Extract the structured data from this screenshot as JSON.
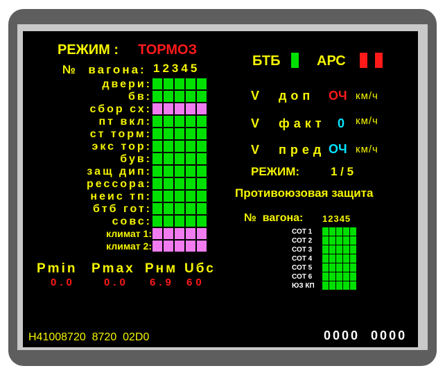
{
  "header": {
    "mode_label": "РЕЖИМ :",
    "mode_value": "ТОРМОЗ",
    "car_label": "№  вагона:",
    "car_numbers": "12345"
  },
  "left_rows": [
    {
      "label": "двери:",
      "state": "green"
    },
    {
      "label": "бв:",
      "state": "green"
    },
    {
      "label": "сбор сх:",
      "state": "pink"
    },
    {
      "label": "пт вкл:",
      "state": "green"
    },
    {
      "label": "ст торм:",
      "state": "green"
    },
    {
      "label": "экс тор:",
      "state": "green"
    },
    {
      "label": "був:",
      "state": "green"
    },
    {
      "label": "защ дип:",
      "state": "green"
    },
    {
      "label": "рессора:",
      "state": "green"
    },
    {
      "label": "неис тп:",
      "state": "green"
    },
    {
      "label": "бтб гот:",
      "state": "green"
    },
    {
      "label": "совс:",
      "state": "green"
    },
    {
      "label": "климат 1:",
      "state": "pink"
    },
    {
      "label": "климат 2:",
      "state": "pink"
    }
  ],
  "pressure": {
    "labels": [
      "Pmin",
      "Pmax",
      "Pнм",
      "Uбс"
    ],
    "values": [
      "0.0",
      "0.0",
      "6.9",
      "60"
    ]
  },
  "right": {
    "btb_label": "БТБ",
    "btb_color": "#00e000",
    "ars_label": "АРС",
    "ars_color": "#ff1a1a",
    "v_dop_label": "V  доп",
    "v_dop_value": "ОЧ",
    "v_dop_unit": "км/ч",
    "v_fakt_label": "V  факт",
    "v_fakt_value": "0",
    "v_fakt_unit": "км/ч",
    "v_pred_label": "V  пред",
    "v_pred_value": "ОЧ",
    "v_pred_unit": "км/ч",
    "mode_label": "РЕЖИМ:",
    "mode_value": "1 / 5",
    "antiskid_title": "Противоюзовая защита",
    "car_label": "№  вагона:",
    "car_numbers": "12345",
    "sot_rows": [
      "СОТ 1",
      "СОТ 2",
      "СОТ 3",
      "СОТ 4",
      "СОТ 5",
      "СОТ 6",
      "ЮЗ КП"
    ]
  },
  "footer": {
    "left": "H41008720  8720  02D0",
    "right": "0000  0000"
  },
  "colors": {
    "green": "#00e000",
    "pink": "#f07cf0",
    "yellow": "#f5f500",
    "red": "#ff1a1a",
    "cyan": "#00e5ff"
  }
}
